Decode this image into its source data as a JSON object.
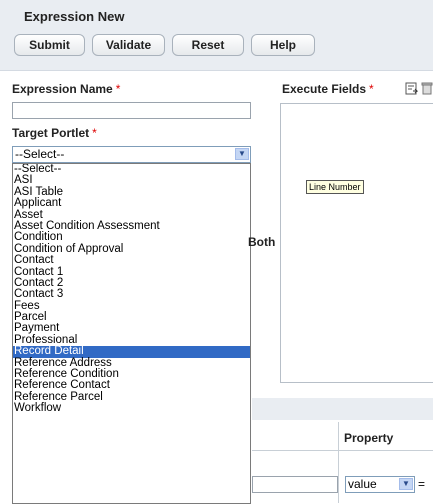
{
  "header": {
    "title": "Expression New",
    "buttons": {
      "submit": "Submit",
      "validate": "Validate",
      "reset": "Reset",
      "help": "Help"
    }
  },
  "form": {
    "expression_name_label": "Expression Name",
    "required_mark": "*",
    "target_portlet_label": "Target Portlet",
    "target_portlet_value": "--Select--",
    "execute_fields_label": "Execute Fields",
    "both_label": "Both"
  },
  "tooltip": "Line Number",
  "target_portlet_options": [
    "--Select--",
    "ASI",
    "ASI Table",
    "Applicant",
    "Asset",
    "Asset Condition Assessment",
    "Condition",
    "Condition of Approval",
    "Contact",
    "Contact 1",
    "Contact 2",
    "Contact 3",
    "Fees",
    "Parcel",
    "Payment",
    "Professional",
    "Record Detail",
    "Reference Address",
    "Reference Condition",
    "Reference Contact",
    "Reference Parcel",
    "Workflow"
  ],
  "selected_option": "Record Detail",
  "table": {
    "property_header": "Property",
    "property_value": "value",
    "trailing_text": "="
  },
  "icons": {
    "export": "export-icon",
    "delete": "trash-icon",
    "dropdown": "chevron-down-icon"
  }
}
